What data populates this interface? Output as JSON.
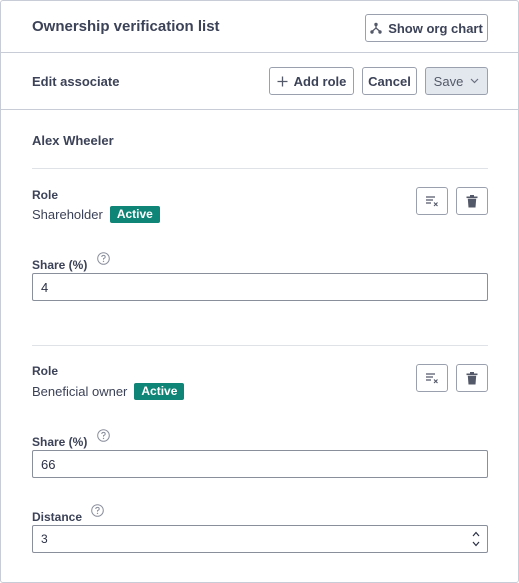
{
  "header": {
    "title": "Ownership verification list",
    "org_chart_label": "Show org chart"
  },
  "subheader": {
    "title": "Edit associate",
    "add_role_label": "Add role",
    "cancel_label": "Cancel",
    "save_label": "Save"
  },
  "associate": {
    "name": "Alex Wheeler"
  },
  "roles": [
    {
      "label": "Role",
      "value": "Shareholder",
      "status": "Active",
      "share_label": "Share (%)",
      "share_value": "4"
    },
    {
      "label": "Role",
      "value": "Beneficial owner",
      "status": "Active",
      "share_label": "Share (%)",
      "share_value": "66",
      "distance_label": "Distance",
      "distance_value": "3"
    }
  ],
  "colors": {
    "badge": "#0e8577",
    "border": "#c8ccd6",
    "text": "#3c4257"
  },
  "icons": [
    "org-chart-icon",
    "plus-icon",
    "chevron-down-icon",
    "clear-filter-icon",
    "trash-icon",
    "help-circle-icon",
    "stepper-arrows-icon"
  ]
}
